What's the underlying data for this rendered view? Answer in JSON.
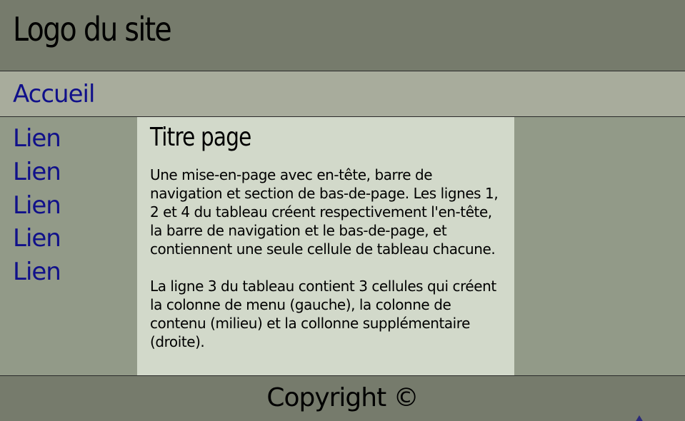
{
  "header": {
    "logo": "Logo du site"
  },
  "nav": {
    "home_label": "Accueil"
  },
  "menu": {
    "items": [
      "Lien",
      "Lien",
      "Lien",
      "Lien",
      "Lien"
    ]
  },
  "content": {
    "title": "Titre page",
    "paragraphs": [
      "Une mise-en-page avec en-tête, barre de navigation et section de bas-de-page. Les lignes 1, 2 et 4 du tableau créent respectivement l'en-tête, la barre de navigation et le bas-de-page, et contiennent une seule cellule de tableau chacune.",
      "La ligne 3 du tableau contient 3 cellules qui créent la colonne de menu (gauche), la colonne de contenu (milieu) et la collonne supplémentaire (droite)."
    ]
  },
  "footer": {
    "copyright": "Copyright ©"
  },
  "icons": {
    "scroll_top": "arrow-up-icon"
  },
  "colors": {
    "header_bg": "#767b6c",
    "nav_bg": "#a8ac9c",
    "side_bg": "#929a88",
    "content_bg": "#d2d9ca",
    "link": "#10108a"
  }
}
